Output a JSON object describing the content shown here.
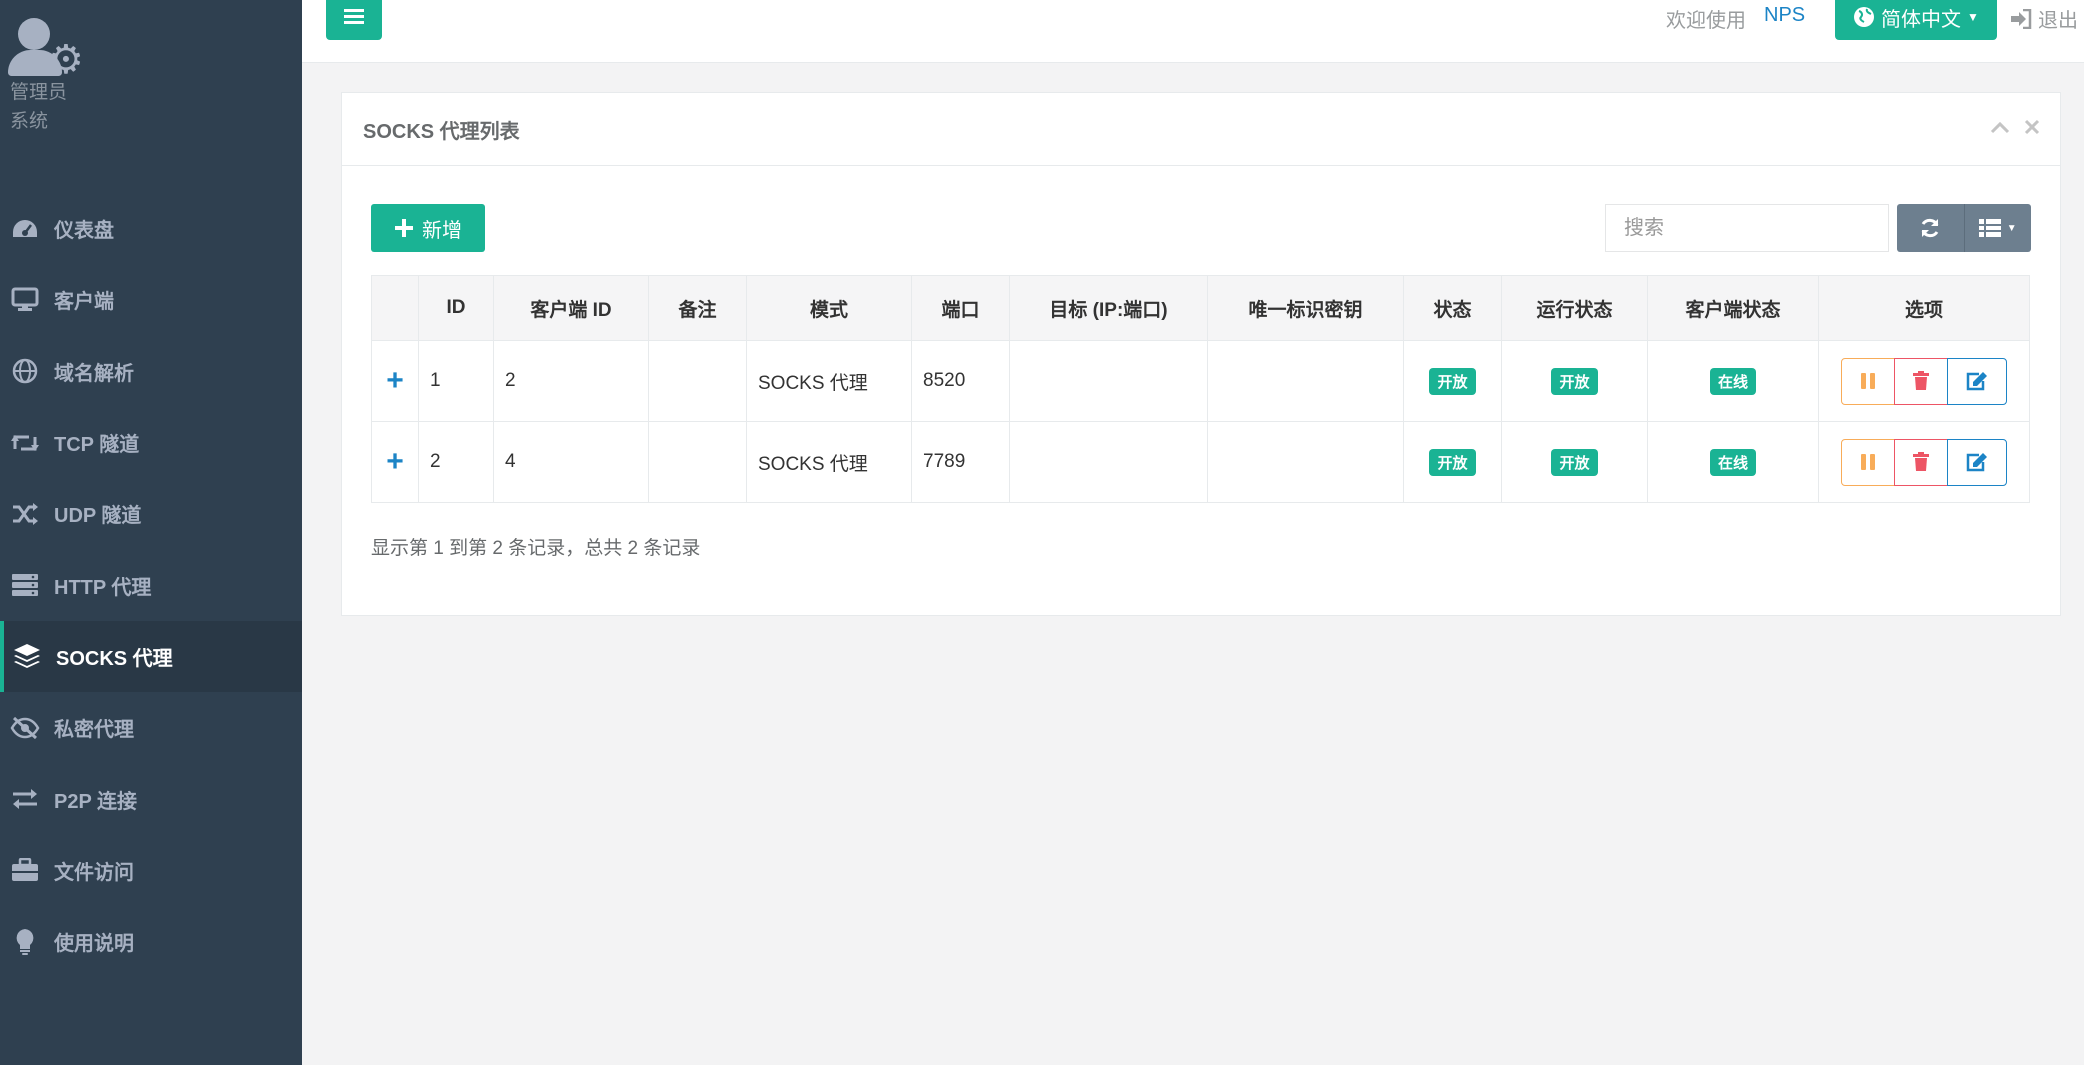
{
  "profile": {
    "name": "管理员",
    "role": "系统"
  },
  "nav": [
    {
      "label": "仪表盘",
      "icon": "dashboard-icon"
    },
    {
      "label": "客户端",
      "icon": "desktop-icon"
    },
    {
      "label": "域名解析",
      "icon": "globe-icon"
    },
    {
      "label": "TCP 隧道",
      "icon": "retweet-icon"
    },
    {
      "label": "UDP 隧道",
      "icon": "random-icon"
    },
    {
      "label": "HTTP 代理",
      "icon": "server-icon"
    },
    {
      "label": "SOCKS 代理",
      "icon": "layers-icon",
      "active": true
    },
    {
      "label": "私密代理",
      "icon": "eye-slash-icon"
    },
    {
      "label": "P2P 连接",
      "icon": "exchange-icon"
    },
    {
      "label": "文件访问",
      "icon": "briefcase-icon"
    },
    {
      "label": "使用说明",
      "icon": "lightbulb-icon"
    }
  ],
  "topbar": {
    "welcome": "欢迎使用",
    "brand": "NPS",
    "language": "简体中文",
    "logout": "退出"
  },
  "panel": {
    "title": "SOCKS 代理列表",
    "add_label": "新增",
    "search_placeholder": "搜索",
    "footer": "显示第 1 到第 2 条记录，总共 2 条记录"
  },
  "table": {
    "columns": [
      "",
      "ID",
      "客户端 ID",
      "备注",
      "模式",
      "端口",
      "目标 (IP:端口)",
      "唯一标识密钥",
      "状态",
      "运行状态",
      "客户端状态",
      "选项"
    ],
    "rows": [
      {
        "expand": "+",
        "id": "1",
        "client_id": "2",
        "remark": "",
        "mode": "SOCKS 代理",
        "port": "8520",
        "target": "",
        "key": "",
        "status": "开放",
        "run_status": "开放",
        "client_status": "在线"
      },
      {
        "expand": "+",
        "id": "2",
        "client_id": "4",
        "remark": "",
        "mode": "SOCKS 代理",
        "port": "7789",
        "target": "",
        "key": "",
        "status": "开放",
        "run_status": "开放",
        "client_status": "在线"
      }
    ]
  },
  "colors": {
    "sidebar": "#2f4050",
    "primary": "#1ab394",
    "link": "#1c84c6",
    "warning": "#f8ac59",
    "danger": "#ed5565"
  }
}
